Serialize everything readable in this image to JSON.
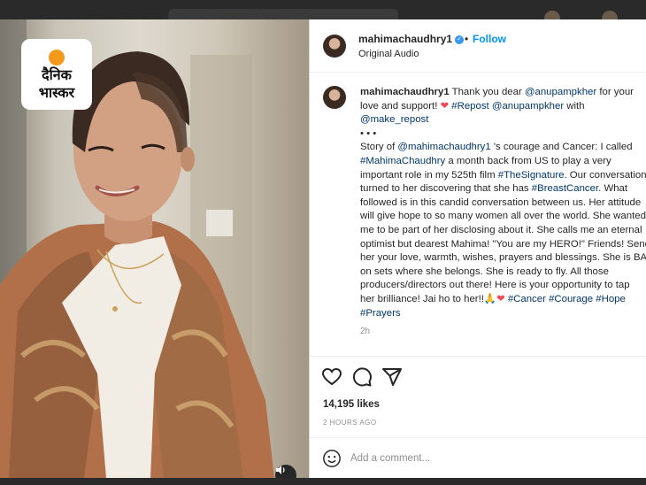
{
  "brand": {
    "logo_line1": "दैनिक",
    "logo_line2": "भास्कर"
  },
  "video": {
    "mute_icon": "volume-icon"
  },
  "post": {
    "username": "mahimachaudhry1",
    "dot": "•",
    "follow_label": "Follow",
    "subtitle": "Original Audio",
    "caption_lines": [
      [
        {
          "t": "mahimachaudhry1",
          "s": "b"
        },
        {
          "t": " Thank you dear "
        },
        {
          "t": "@anupampkher",
          "s": "tag"
        },
        {
          "t": " for your"
        }
      ],
      [
        {
          "t": "love and support! "
        },
        {
          "t": "❤",
          "s": "heart"
        },
        {
          "t": " "
        },
        {
          "t": "#Repost",
          "s": "tag"
        },
        {
          "t": " "
        },
        {
          "t": "@anupampkher",
          "s": "tag"
        },
        {
          "t": " with"
        }
      ],
      [
        {
          "t": "@make_repost",
          "s": "tag"
        }
      ],
      [
        {
          "t": "• • •"
        }
      ],
      [
        {
          "t": "Story of "
        },
        {
          "t": "@mahimachaudhry1",
          "s": "tag"
        },
        {
          "t": " 's courage and Cancer: I called"
        }
      ],
      [
        {
          "t": "#MahimaChaudhry",
          "s": "tag"
        },
        {
          "t": " a month back from US to play a very"
        }
      ],
      [
        {
          "t": "important role in my 525th film "
        },
        {
          "t": "#TheSignature",
          "s": "tag"
        },
        {
          "t": ". Our conversation"
        }
      ],
      [
        {
          "t": "turned to her discovering that she has "
        },
        {
          "t": "#BreastCancer",
          "s": "tag"
        },
        {
          "t": ". What"
        }
      ],
      [
        {
          "t": "followed is in this candid conversation between us. Her attitude"
        }
      ],
      [
        {
          "t": "will give hope to so many women all over the world. She wanted"
        }
      ],
      [
        {
          "t": "me to be part of her disclosing about it. She calls me an eternal"
        }
      ],
      [
        {
          "t": "optimist but dearest Mahima! \"You are my HERO!\" Friends! Send"
        }
      ],
      [
        {
          "t": "her your love, warmth, wishes, prayers and blessings. She is BACK"
        }
      ],
      [
        {
          "t": "on sets where she belongs. She is ready to fly. All those"
        }
      ],
      [
        {
          "t": "producers/directors out there! Here is your opportunity to tap"
        }
      ],
      [
        {
          "t": "her brilliance! Jai ho to her!!🙏"
        },
        {
          "t": "❤",
          "s": "heart"
        },
        {
          "t": " "
        },
        {
          "t": "#Cancer",
          "s": "tag"
        },
        {
          "t": " "
        },
        {
          "t": "#Courage",
          "s": "tag"
        },
        {
          "t": " "
        },
        {
          "t": "#Hope",
          "s": "tag"
        }
      ],
      [
        {
          "t": "#Prayers",
          "s": "tag"
        }
      ]
    ],
    "time": "2h",
    "likes": "14,195 likes",
    "posted_ago": "2 HOURS AGO",
    "comment_placeholder": "Add a comment..."
  },
  "icons": {
    "like": "heart-icon",
    "comment": "comment-icon",
    "share": "share-icon",
    "emoji": "emoji-icon",
    "verified": "verified-badge-icon"
  },
  "colors": {
    "link": "#0095f6",
    "hashtag": "#00376b",
    "heart": "#ed4956",
    "muted": "#8e8e8e"
  }
}
